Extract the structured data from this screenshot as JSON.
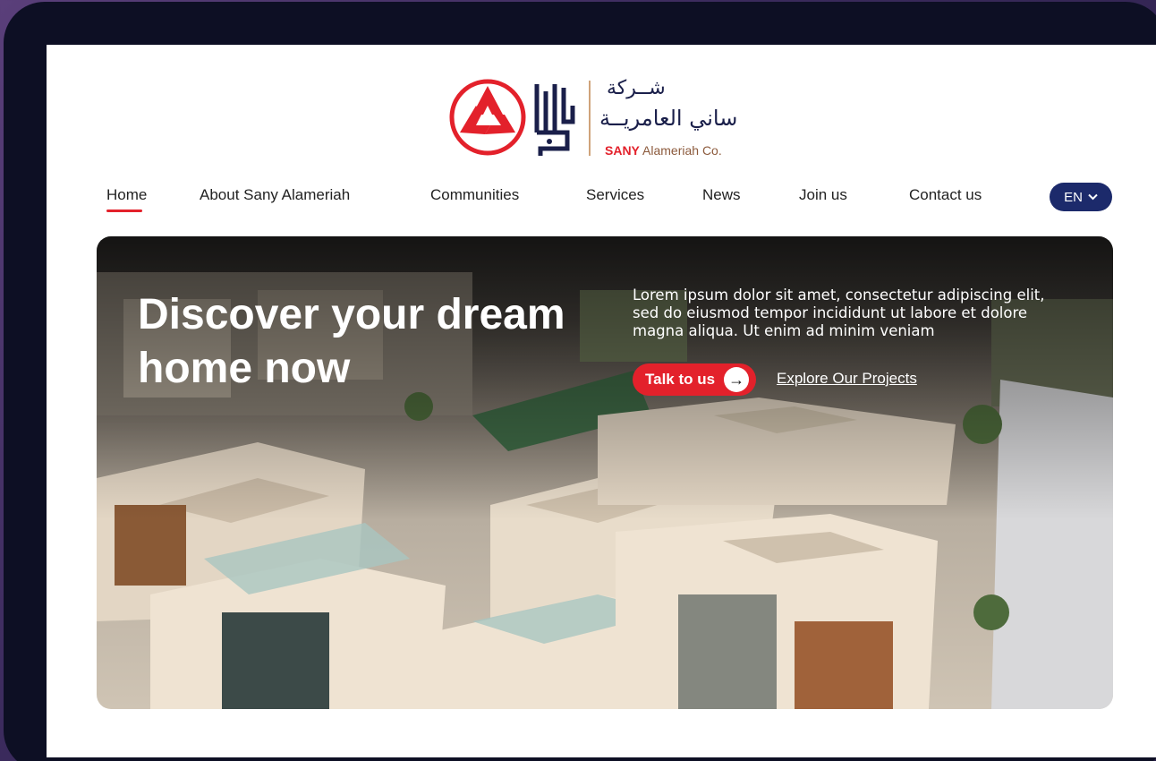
{
  "logo": {
    "arabic_line1": "شــركة",
    "arabic_line2": "ساني العامريــة",
    "brand": "SANY",
    "company": "Alameriah Co."
  },
  "nav": {
    "items": [
      {
        "label": "Home",
        "active": true
      },
      {
        "label": "About Sany  Alameriah"
      },
      {
        "label": "Communities"
      },
      {
        "label": "Services"
      },
      {
        "label": "News"
      },
      {
        "label": "Join  us"
      },
      {
        "label": "Contact  us"
      }
    ],
    "language": "EN"
  },
  "hero": {
    "title": "Discover your dream home now",
    "description": "Lorem ipsum dolor sit amet, consectetur adipiscing elit, sed do eiusmod tempor incididunt ut labore et dolore magna aliqua. Ut enim ad minim veniam",
    "primary_button": "Talk to us",
    "secondary_link": "Explore Our Projects"
  },
  "colors": {
    "accent_red": "#e3212b",
    "navy": "#1c2a6b",
    "device_frame": "#0d0f24"
  }
}
